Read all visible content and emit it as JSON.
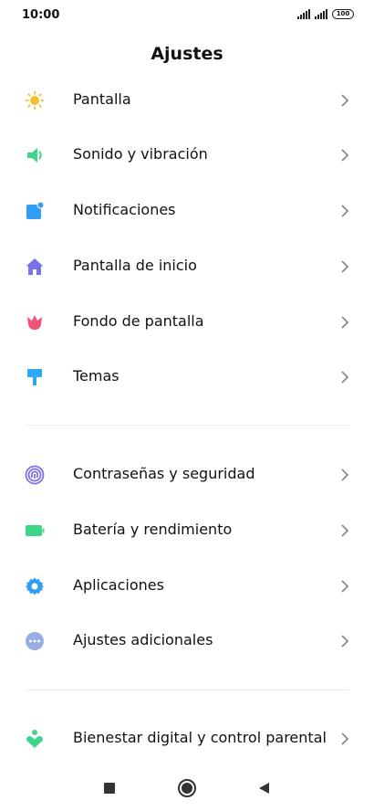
{
  "status_bar": {
    "time": "10:00",
    "battery_level": "100"
  },
  "header": {
    "title": "Ajustes"
  },
  "groups": [
    {
      "items": [
        {
          "label": "Pantalla",
          "icon": "sun-icon",
          "color": "#f5c02f"
        },
        {
          "label": "Sonido y vibración",
          "icon": "speaker-icon",
          "color": "#3ed48a"
        },
        {
          "label": "Notificaciones",
          "icon": "notification-icon",
          "color": "#2f9ef5"
        },
        {
          "label": "Pantalla de inicio",
          "icon": "home-icon",
          "color": "#7b72e9"
        },
        {
          "label": "Fondo de pantalla",
          "icon": "tulip-icon",
          "color": "#f0527a"
        },
        {
          "label": "Temas",
          "icon": "paint-roller-icon",
          "color": "#2fa8f5"
        }
      ]
    },
    {
      "items": [
        {
          "label": "Contraseñas y seguridad",
          "icon": "fingerprint-icon",
          "color": "#7b72e9"
        },
        {
          "label": "Batería y rendimiento",
          "icon": "battery-icon",
          "color": "#3ed48a"
        },
        {
          "label": "Aplicaciones",
          "icon": "gear-icon",
          "color": "#2f9ef5"
        },
        {
          "label": "Ajustes adicionales",
          "icon": "more-icon",
          "color": "#9aaee6"
        }
      ]
    },
    {
      "items": [
        {
          "label": "Bienestar digital y control parental",
          "icon": "wellbeing-icon",
          "color": "#3ed48a"
        }
      ]
    }
  ],
  "nav_bar": {
    "buttons": [
      "recents-icon",
      "home-icon",
      "back-icon"
    ]
  }
}
